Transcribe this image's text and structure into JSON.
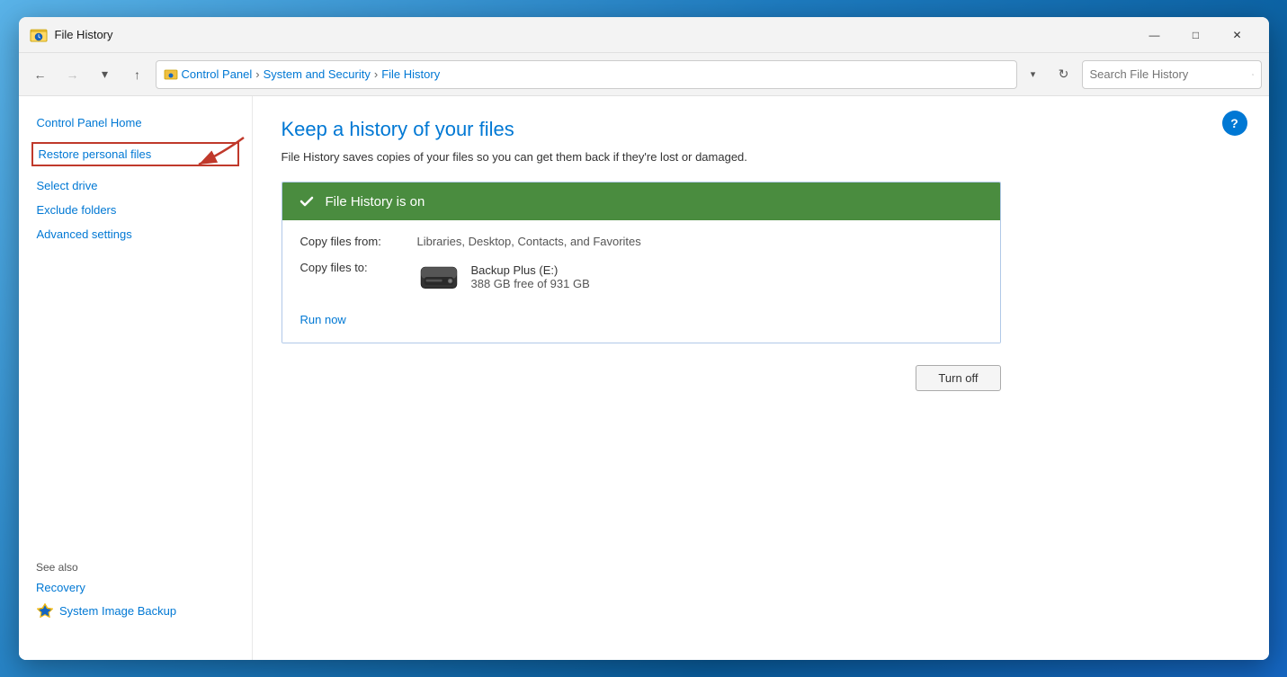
{
  "window": {
    "title": "File History",
    "minimize_label": "—",
    "maximize_label": "□",
    "close_label": "✕"
  },
  "addressbar": {
    "back_btn": "←",
    "forward_btn": "→",
    "dropdown_btn": "▾",
    "up_btn": "↑",
    "path": {
      "control_panel": "Control Panel",
      "system_security": "System and Security",
      "file_history": "File History"
    },
    "refresh_btn": "↻",
    "search_placeholder": "Search File History"
  },
  "sidebar": {
    "control_panel_home": "Control Panel Home",
    "restore_personal_files": "Restore personal files",
    "select_drive": "Select drive",
    "exclude_folders": "Exclude folders",
    "advanced_settings": "Advanced settings",
    "see_also_label": "See also",
    "recovery": "Recovery",
    "system_image_backup": "System Image Backup"
  },
  "content": {
    "title": "Keep a history of your files",
    "description": "File History saves copies of your files so you can get them back if they're lost or damaged.",
    "status_header": "File History is on",
    "copy_from_label": "Copy files from:",
    "copy_from_value": "Libraries, Desktop, Contacts, and Favorites",
    "copy_to_label": "Copy files to:",
    "drive_name": "Backup Plus (E:)",
    "drive_free": "388 GB free of 931 GB",
    "run_now": "Run now",
    "turn_off": "Turn off"
  },
  "help_btn": "?",
  "colors": {
    "link": "#0078d4",
    "status_green": "#2d7d32",
    "header_green": "#3d7d38"
  }
}
